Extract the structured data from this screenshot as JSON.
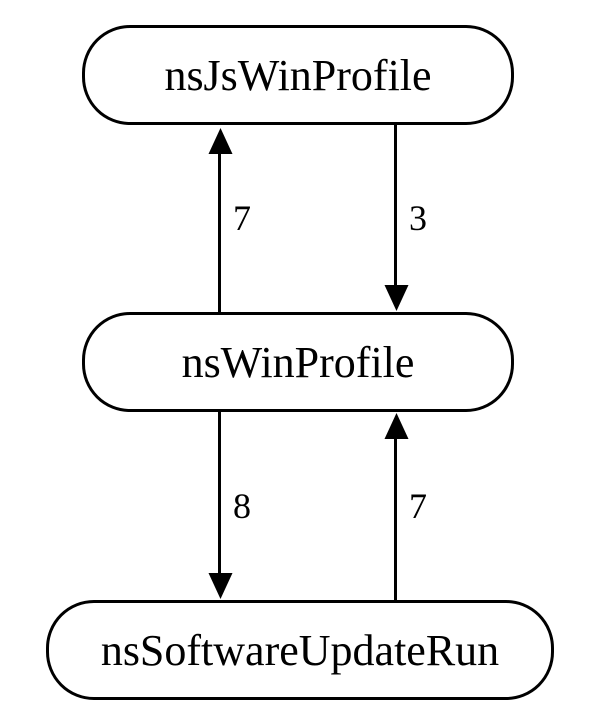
{
  "nodes": {
    "top": {
      "label": "nsJsWinProfile"
    },
    "middle": {
      "label": "nsWinProfile"
    },
    "bottom": {
      "label": "nsSoftwareUpdateRun"
    }
  },
  "edges": {
    "mid_to_top": {
      "label": "7"
    },
    "top_to_mid": {
      "label": "3"
    },
    "mid_to_bottom": {
      "label": "8"
    },
    "bottom_to_mid": {
      "label": "7"
    }
  }
}
